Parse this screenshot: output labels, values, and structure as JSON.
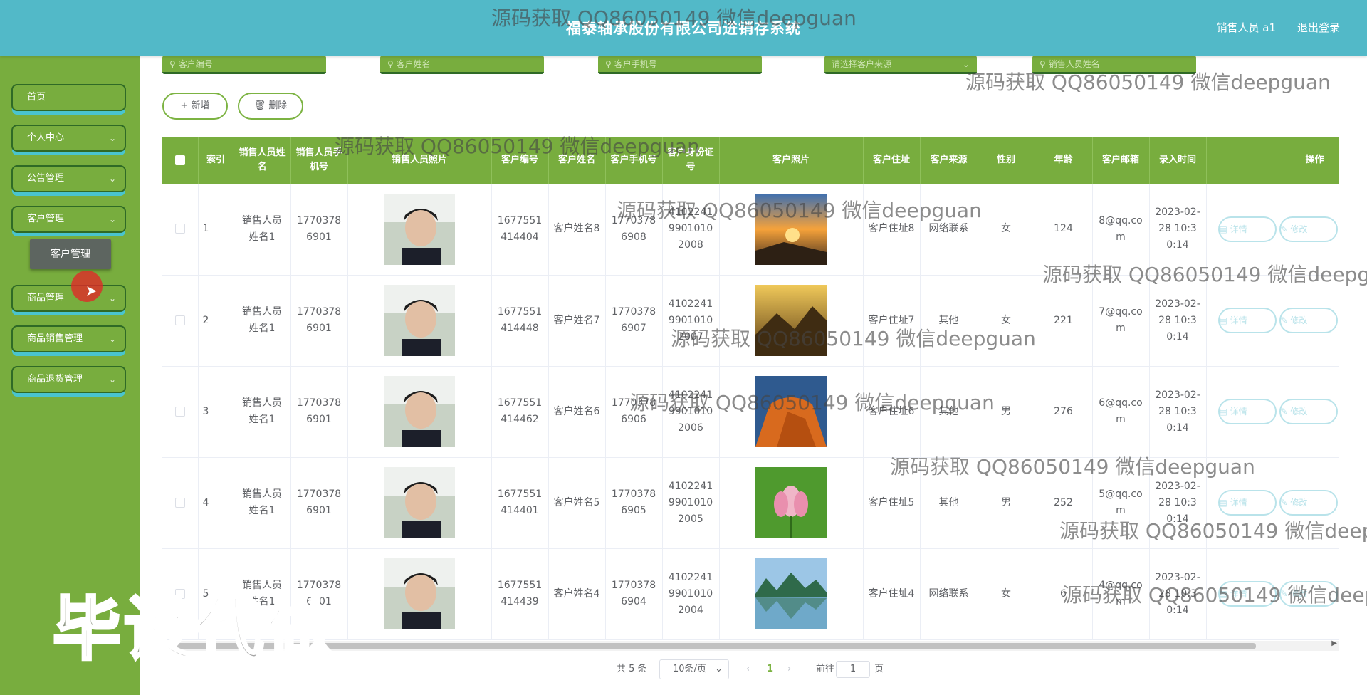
{
  "header": {
    "title": "福泰轴承股份有限公司进销存系统",
    "user": "销售人员 a1",
    "logout": "退出登录"
  },
  "sidebar": {
    "items": [
      {
        "label": "首页"
      },
      {
        "label": "个人中心"
      },
      {
        "label": "公告管理"
      },
      {
        "label": "客户管理"
      },
      {
        "label": "商品管理"
      },
      {
        "label": "商品销售管理"
      },
      {
        "label": "商品退货管理"
      }
    ],
    "submenu": "客户管理"
  },
  "search": {
    "customer_no": "客户编号",
    "customer_name": "客户姓名",
    "customer_phone": "客户手机号",
    "customer_source": "请选择客户来源",
    "sales_name": "销售人员姓名"
  },
  "toolbar": {
    "add": "新增",
    "delete": "删除"
  },
  "table": {
    "headers": {
      "index": "索引",
      "sales_name": "销售人员姓名",
      "sales_phone": "销售人员手机号",
      "sales_photo": "销售人员照片",
      "cust_no": "客户编号",
      "cust_name": "客户姓名",
      "cust_phone": "客户手机号",
      "cust_id": "客户身份证号",
      "cust_photo": "客户照片",
      "cust_addr": "客户住址",
      "cust_source": "客户来源",
      "gender": "性别",
      "age": "年龄",
      "email": "客户邮箱",
      "time": "录入时间",
      "ops": "操作"
    },
    "rows": [
      {
        "index": "1",
        "sales_name": "销售人员姓名1",
        "sales_phone": "17703786901",
        "cust_no": "1677551414404",
        "cust_name": "客户姓名8",
        "cust_phone": "17703786908",
        "cust_id": "410224199010102008",
        "cust_addr": "客户住址8",
        "source": "网络联系",
        "gender": "女",
        "age": "124",
        "email": "8@qq.com",
        "time": "2023-02-28 10:30:14"
      },
      {
        "index": "2",
        "sales_name": "销售人员姓名1",
        "sales_phone": "17703786901",
        "cust_no": "1677551414448",
        "cust_name": "客户姓名7",
        "cust_phone": "17703786907",
        "cust_id": "410224199010102007",
        "cust_addr": "客户住址7",
        "source": "其他",
        "gender": "女",
        "age": "221",
        "email": "7@qq.com",
        "time": "2023-02-28 10:30:14"
      },
      {
        "index": "3",
        "sales_name": "销售人员姓名1",
        "sales_phone": "17703786901",
        "cust_no": "1677551414462",
        "cust_name": "客户姓名6",
        "cust_phone": "17703786906",
        "cust_id": "410224199010102006",
        "cust_addr": "客户住址6",
        "source": "其他",
        "gender": "男",
        "age": "276",
        "email": "6@qq.com",
        "time": "2023-02-28 10:30:14"
      },
      {
        "index": "4",
        "sales_name": "销售人员姓名1",
        "sales_phone": "17703786901",
        "cust_no": "1677551414401",
        "cust_name": "客户姓名5",
        "cust_phone": "17703786905",
        "cust_id": "410224199010102005",
        "cust_addr": "客户住址5",
        "source": "其他",
        "gender": "男",
        "age": "252",
        "email": "5@qq.com",
        "time": "2023-02-28 10:30:14"
      },
      {
        "index": "5",
        "sales_name": "销售人员姓名1",
        "sales_phone": "17703786901",
        "cust_no": "1677551414439",
        "cust_name": "客户姓名4",
        "cust_phone": "17703786904",
        "cust_id": "410224199010102004",
        "cust_addr": "客户住址4",
        "source": "网络联系",
        "gender": "女",
        "age": "6",
        "email": "4@qq.com",
        "time": "2023-02-28 10:30:14"
      }
    ],
    "detail": "详情",
    "edit": "修改"
  },
  "pagination": {
    "total": "共 5 条",
    "page_size": "10条/页",
    "current": "1",
    "goto": "前往",
    "page": "页"
  },
  "watermark": {
    "text": "源码获取 QQ86050149 微信deepguan",
    "big": "毕设代做"
  },
  "colors": {
    "header": "#52b9c8",
    "sidebar": "#78ad3e",
    "table_header": "#78ad3e",
    "accent": "#7cb342"
  }
}
